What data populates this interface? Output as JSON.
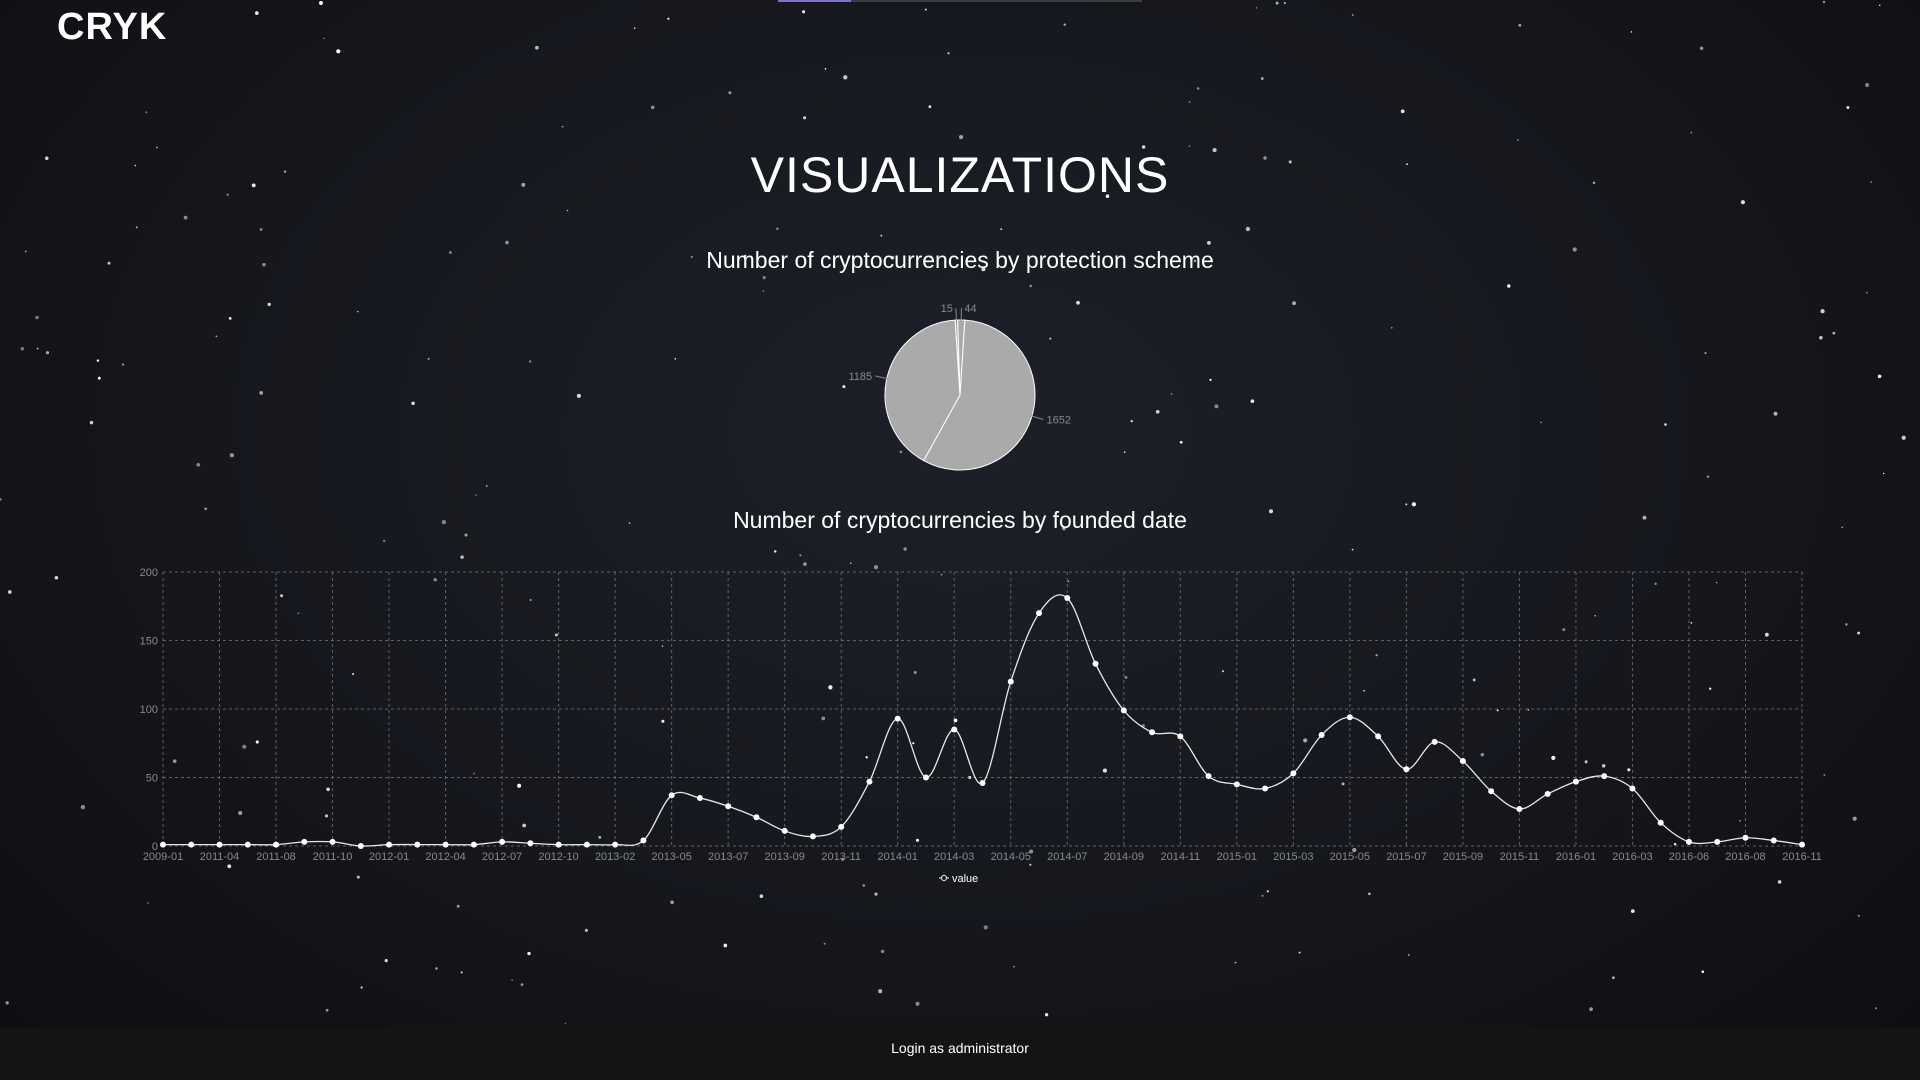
{
  "header": {
    "logo": "CRYK"
  },
  "page": {
    "title": "VISUALIZATIONS"
  },
  "theme": {
    "background": "#15171d",
    "nav_accent": "#7f72c9",
    "chart_color": "#aaaaaa",
    "line_color": "#ffffff"
  },
  "footer": {
    "login_label": "Login as administrator"
  },
  "chart_data": [
    {
      "type": "pie",
      "title": "Number of cryptocurrencies by protection scheme",
      "labels": [
        "1652",
        "1185",
        "15",
        "44"
      ],
      "values": [
        1652,
        1185,
        15,
        44
      ]
    },
    {
      "type": "line",
      "title": "Number of cryptocurrencies by founded date",
      "legend": "value",
      "legend_position": "bottom",
      "grid": true,
      "ylim": [
        0,
        200
      ],
      "yticks": [
        0,
        50,
        100,
        150,
        200
      ],
      "xtick_labels": [
        "2009-01",
        "2011-04",
        "2011-08",
        "2011-10",
        "2012-01",
        "2012-04",
        "2012-07",
        "2012-10",
        "2013-02",
        "2013-05",
        "2013-07",
        "2013-09",
        "2013-11",
        "2014-01",
        "2014-03",
        "2014-05",
        "2014-07",
        "2014-09",
        "2014-11",
        "2015-01",
        "2015-03",
        "2015-05",
        "2015-07",
        "2015-09",
        "2015-11",
        "2016-01",
        "2016-03",
        "2016-06",
        "2016-08",
        "2016-11"
      ],
      "series": [
        {
          "name": "value",
          "values": [
            1,
            1,
            1,
            1,
            1,
            3,
            3,
            0,
            1,
            1,
            1,
            1,
            3,
            2,
            1,
            1,
            1,
            4,
            37,
            35,
            29,
            21,
            11,
            7,
            14,
            47,
            93,
            50,
            85,
            46,
            120,
            170,
            181,
            133,
            99,
            83,
            80,
            51,
            45,
            42,
            53,
            81,
            94,
            80,
            56,
            76,
            62,
            40,
            27,
            38,
            47,
            51,
            42,
            17,
            3,
            3,
            6,
            4,
            1
          ]
        }
      ]
    }
  ]
}
